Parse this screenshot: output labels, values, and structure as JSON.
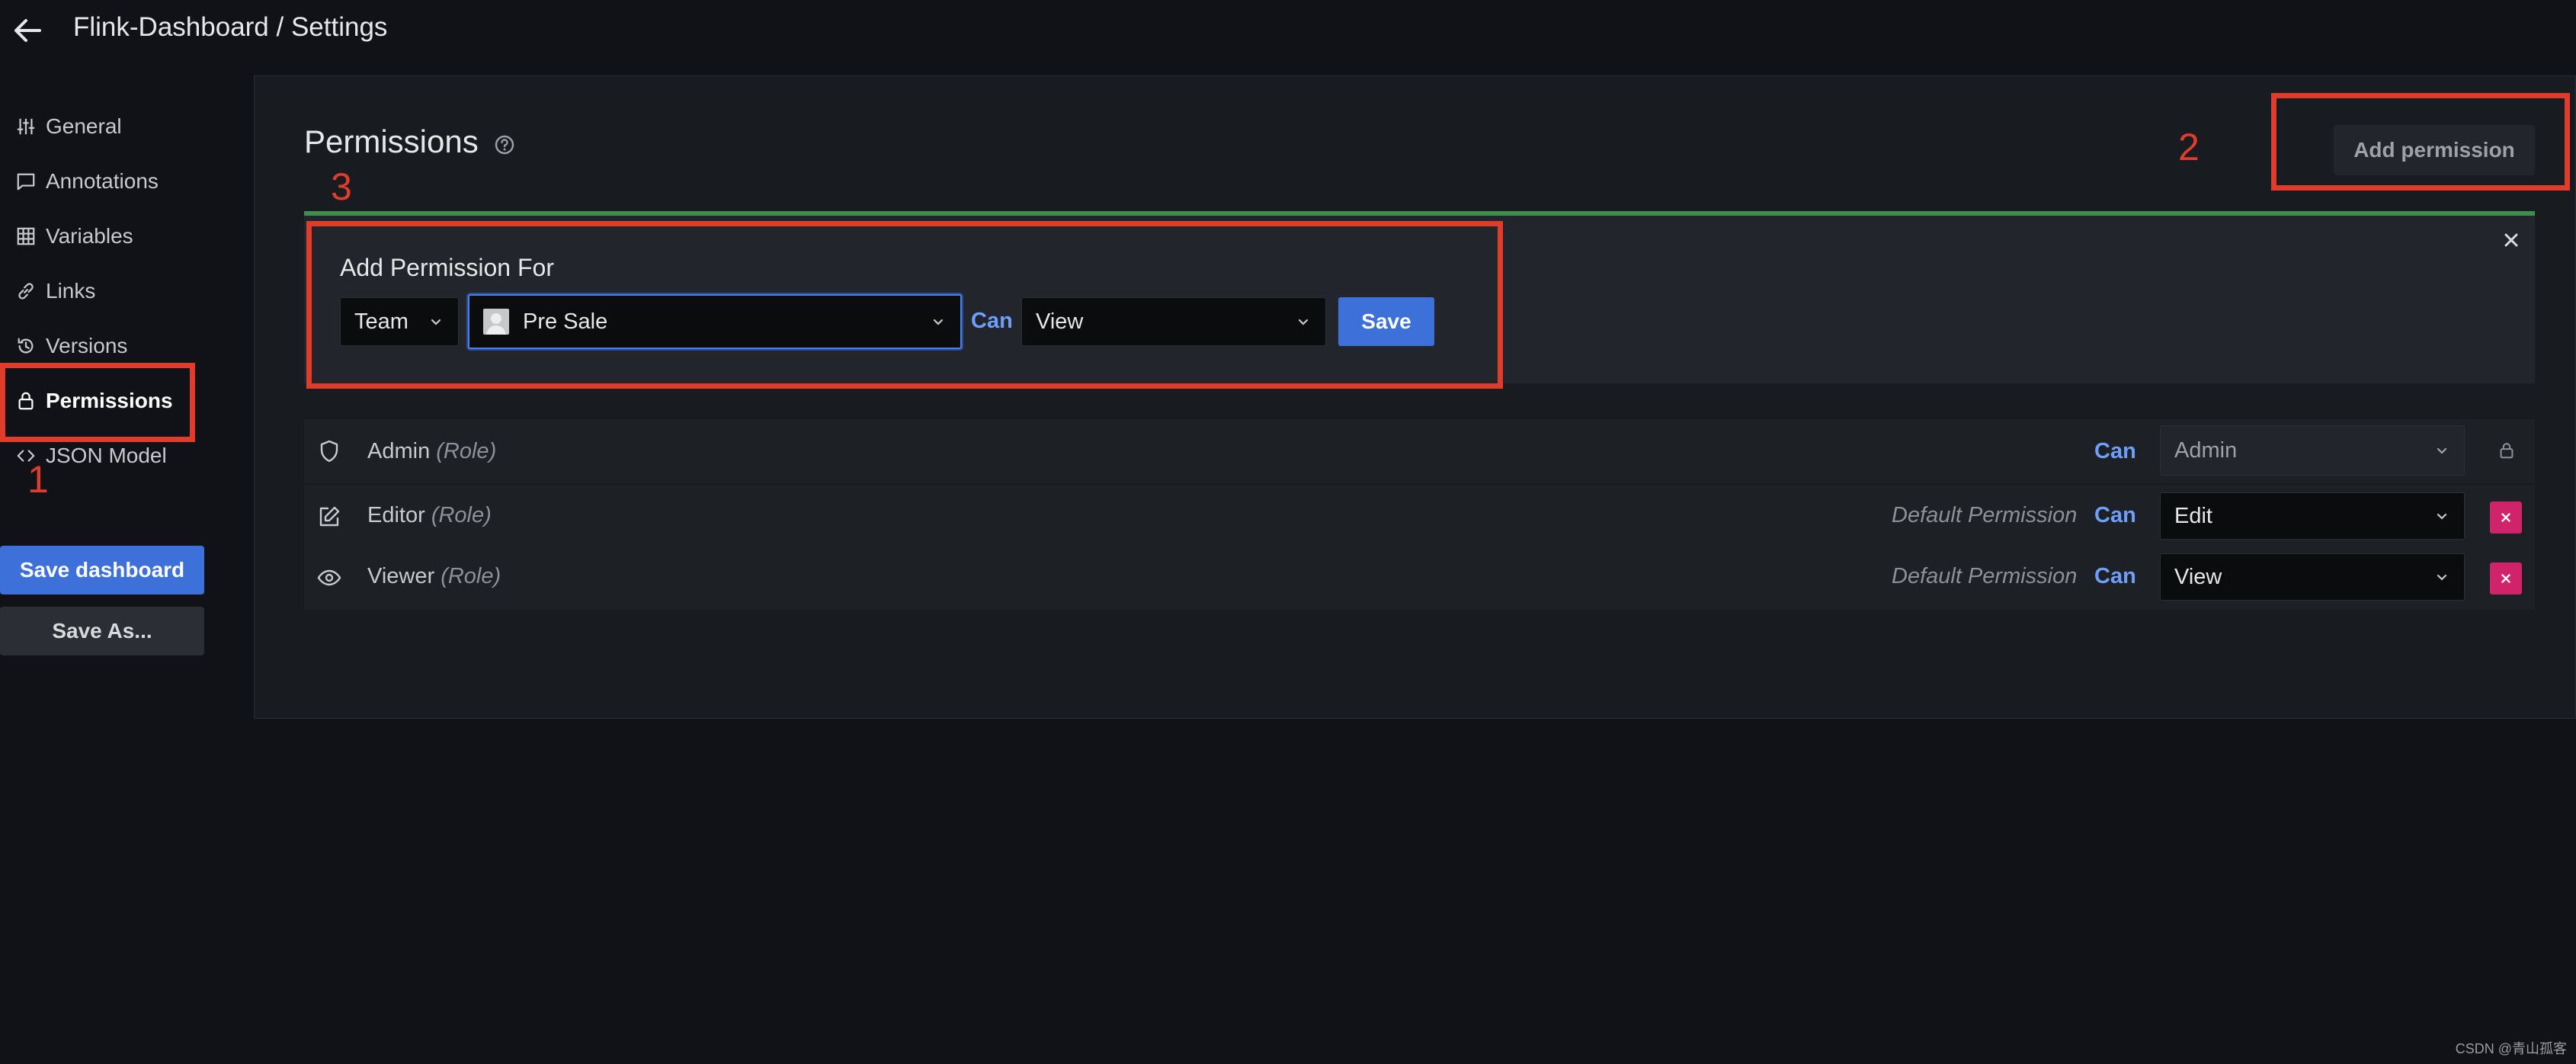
{
  "header": {
    "title": "Flink-Dashboard / Settings"
  },
  "sidebar": {
    "items": [
      {
        "label": "General",
        "icon": "sliders-icon"
      },
      {
        "label": "Annotations",
        "icon": "comment-icon"
      },
      {
        "label": "Variables",
        "icon": "table-icon"
      },
      {
        "label": "Links",
        "icon": "link-icon"
      },
      {
        "label": "Versions",
        "icon": "history-icon"
      },
      {
        "label": "Permissions",
        "icon": "lock-icon",
        "active": true
      },
      {
        "label": "JSON Model",
        "icon": "code-icon"
      }
    ],
    "save_dashboard_label": "Save dashboard",
    "save_as_label": "Save As..."
  },
  "main": {
    "title": "Permissions",
    "add_permission_label": "Add permission",
    "add_form": {
      "heading": "Add Permission For",
      "type_value": "Team",
      "team_value": "Pre Sale",
      "can_label": "Can",
      "permission_value": "View",
      "save_label": "Save"
    },
    "rows": [
      {
        "name": "Admin",
        "role": "(Role)",
        "default": "",
        "can": "Can",
        "permission": "Admin",
        "icon": "shield-icon",
        "locked": true
      },
      {
        "name": "Editor",
        "role": "(Role)",
        "default": "Default Permission",
        "can": "Can",
        "permission": "Edit",
        "icon": "edit-icon",
        "locked": false
      },
      {
        "name": "Viewer",
        "role": "(Role)",
        "default": "Default Permission",
        "can": "Can",
        "permission": "View",
        "icon": "eye-icon",
        "locked": false
      }
    ]
  },
  "annotations": [
    "1",
    "2",
    "3"
  ],
  "watermark": "CSDN @青山孤客",
  "colors": {
    "accent": "#3d71d9",
    "highlight": "#e03c2b",
    "success": "#3e8d4e",
    "danger": "#d1236a",
    "can_text": "#6e9fff"
  }
}
